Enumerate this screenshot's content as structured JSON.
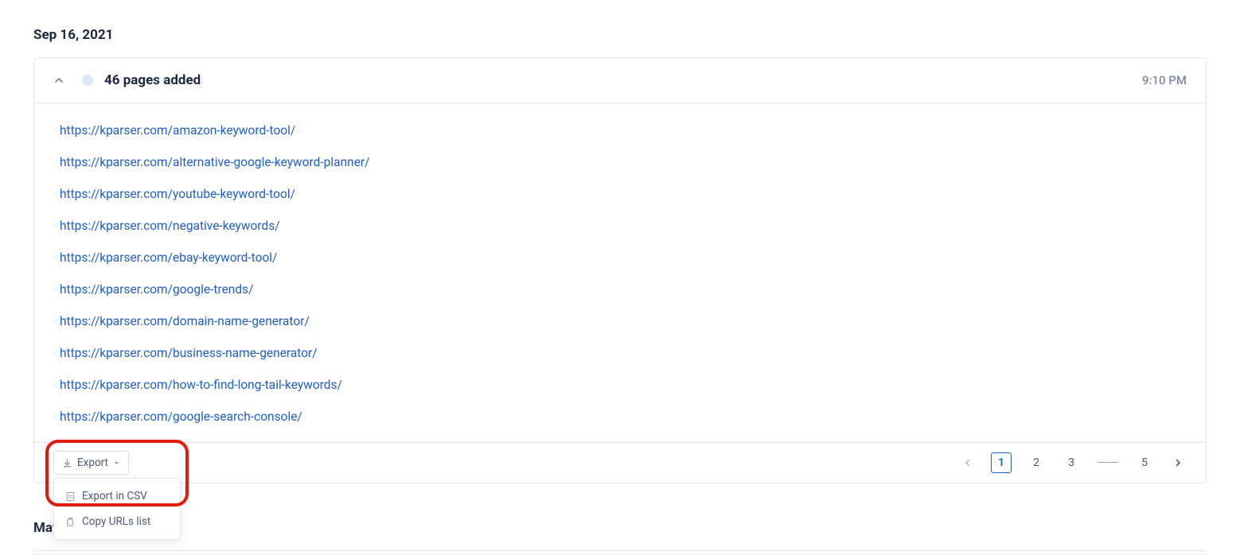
{
  "dates": {
    "primary": "Sep 16, 2021",
    "secondary": "May"
  },
  "summary": {
    "title": "46 pages added",
    "time": "9:10 PM"
  },
  "links": [
    "https://kparser.com/amazon-keyword-tool/",
    "https://kparser.com/alternative-google-keyword-planner/",
    "https://kparser.com/youtube-keyword-tool/",
    "https://kparser.com/negative-keywords/",
    "https://kparser.com/ebay-keyword-tool/",
    "https://kparser.com/google-trends/",
    "https://kparser.com/domain-name-generator/",
    "https://kparser.com/business-name-generator/",
    "https://kparser.com/how-to-find-long-tail-keywords/",
    "https://kparser.com/google-search-console/"
  ],
  "export": {
    "label": "Export",
    "menu": {
      "csv": "Export in CSV",
      "copy": "Copy URLs list"
    }
  },
  "pagination": {
    "current": "1",
    "pages": {
      "p2": "2",
      "p3": "3",
      "last": "5"
    }
  }
}
